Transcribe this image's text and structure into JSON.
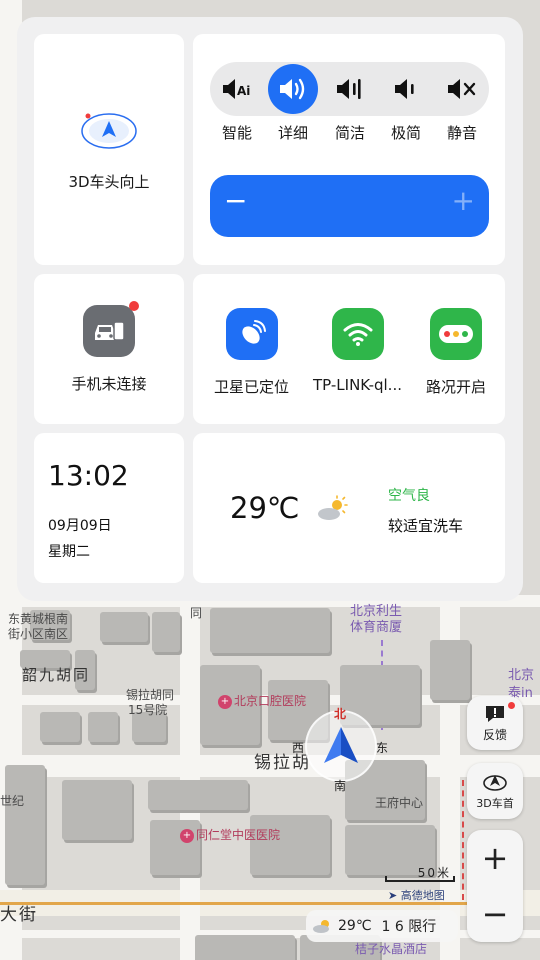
{
  "panel": {
    "car_heading": {
      "label": "3D车头向上"
    },
    "voice": {
      "options": [
        {
          "label": "智能",
          "icon": "speaker-ai-icon"
        },
        {
          "label": "详细",
          "icon": "speaker-full-icon",
          "selected": true
        },
        {
          "label": "简洁",
          "icon": "speaker-medium-icon"
        },
        {
          "label": "极简",
          "icon": "speaker-low-icon"
        },
        {
          "label": "静音",
          "icon": "speaker-mute-icon"
        }
      ],
      "volume_minus": "−",
      "volume_plus": "+"
    },
    "phone": {
      "label": "手机未连接"
    },
    "status": {
      "satellite": "卫星已定位",
      "wifi": "TP-LINK-ql...",
      "traffic": "路况开启"
    },
    "clock": {
      "time": "13:02",
      "date": "09月09日",
      "weekday": "星期二"
    },
    "weather": {
      "temp": "29℃",
      "air": "空气良",
      "advice": "较适宜洗车"
    }
  },
  "map": {
    "labels": {
      "street_main": "锡拉胡",
      "street_west": "韶九胡同",
      "street_bottom": "大街",
      "lane_1": "东黄城根南",
      "lane_2": "街小区南区",
      "xila": "锡拉胡同",
      "xila_no": "15号院",
      "tong": "同",
      "sports_1": "北京利生",
      "sports_2": "体育商厦",
      "wangfu": "王府中心",
      "ji": "世纪",
      "dental": "北京口腔医院",
      "tcm": "同仁堂中医医院",
      "hotel": "桔子水晶酒店",
      "right_1": "北京",
      "right_2": "泰in",
      "amap": "高德地图",
      "scale": "50米"
    },
    "compass": {
      "n": "北",
      "s": "南",
      "w": "西",
      "e": "东"
    }
  },
  "controls": {
    "feedback": "反馈",
    "view3d": "3D车首",
    "zoom_in": "+",
    "zoom_out": "−"
  },
  "bottom_bar": {
    "temp": "29℃",
    "limit": "1 6 限行"
  },
  "colors": {
    "accent": "#1f6ff5",
    "green": "#2fb64a",
    "air_good": "#2fb64a",
    "dot_red": "#f03c3c"
  }
}
